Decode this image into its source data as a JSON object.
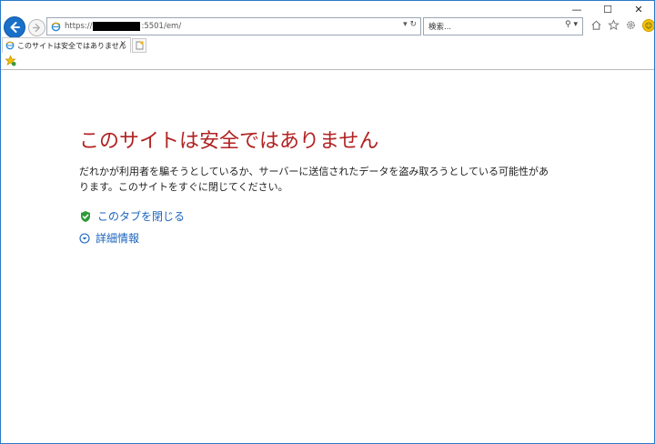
{
  "window": {
    "caption_minimize": "—",
    "caption_maximize": "☐",
    "caption_close": "✕"
  },
  "address_bar": {
    "url_prefix": "https://",
    "url_suffix": ":5501/em/",
    "tools": "▾ ↻"
  },
  "search_box": {
    "placeholder": "検索...",
    "tools": "⚲ ▾"
  },
  "tab": {
    "title": "このサイトは安全ではありません",
    "close_label": "✕"
  },
  "page": {
    "title": "このサイトは安全ではありません",
    "description": "だれかが利用者を騙そうとしているか、サーバーに送信されたデータを盗み取ろうとしている可能性があります。このサイトをすぐに閉じてください。",
    "close_tab_link": "このタブを閉じる",
    "details_link": "詳細情報"
  },
  "colors": {
    "title": "#b22222",
    "link": "#1b64bd",
    "accent": "#1a6fc9"
  }
}
